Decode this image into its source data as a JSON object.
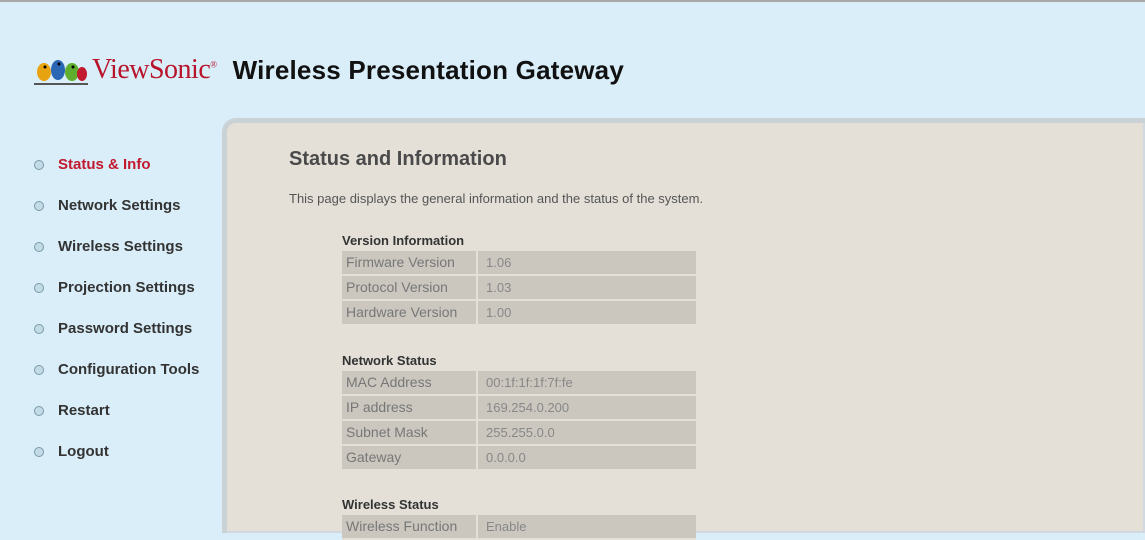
{
  "header": {
    "brand": "ViewSonic",
    "brand_mark": "®",
    "product": "Wireless Presentation Gateway"
  },
  "sidebar": {
    "items": [
      {
        "label": "Status & Info",
        "active": true
      },
      {
        "label": "Network Settings"
      },
      {
        "label": "Wireless Settings"
      },
      {
        "label": "Projection Settings"
      },
      {
        "label": "Password Settings"
      },
      {
        "label": "Configuration Tools"
      },
      {
        "label": "Restart"
      },
      {
        "label": "Logout"
      }
    ]
  },
  "main": {
    "title": "Status and Information",
    "description": "This page displays the general information and the status of the system.",
    "version": {
      "title": "Version Information",
      "rows": [
        {
          "label": "Firmware Version",
          "value": "1.06"
        },
        {
          "label": "Protocol Version",
          "value": "1.03"
        },
        {
          "label": "Hardware Version",
          "value": "1.00"
        }
      ]
    },
    "network": {
      "title": "Network Status",
      "rows": [
        {
          "label": "MAC Address",
          "value": "00:1f:1f:1f:7f:fe"
        },
        {
          "label": "IP address",
          "value": "169.254.0.200"
        },
        {
          "label": "Subnet Mask",
          "value": "255.255.0.0"
        },
        {
          "label": "Gateway",
          "value": "0.0.0.0"
        }
      ]
    },
    "wireless": {
      "title": "Wireless Status",
      "rows": [
        {
          "label": "Wireless Function",
          "value": "Enable"
        }
      ]
    }
  },
  "colors": {
    "background": "#d9eef9",
    "content_bg": "#e4e0d8",
    "active_link": "#c2192f",
    "row_bg": "#cbc7bf"
  }
}
